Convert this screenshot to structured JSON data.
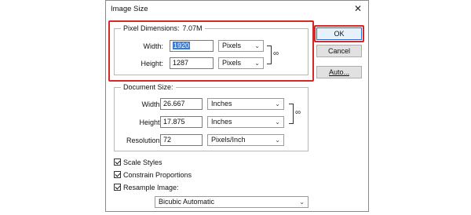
{
  "dialog": {
    "title": "Image Size",
    "close_glyph": "✕"
  },
  "pixel_dimensions": {
    "label": "Pixel Dimensions:",
    "value": "7.07M",
    "width_label": "Width:",
    "width_value": "1920",
    "width_unit": "Pixels",
    "height_label": "Height:",
    "height_value": "1287",
    "height_unit": "Pixels",
    "link_icon": "chain-link"
  },
  "document_size": {
    "label": "Document Size:",
    "width_label": "Width:",
    "width_value": "26.667",
    "width_unit": "Inches",
    "height_label": "Height:",
    "height_value": "17.875",
    "height_unit": "Inches",
    "resolution_label": "Resolution:",
    "resolution_value": "72",
    "resolution_unit": "Pixels/Inch"
  },
  "buttons": {
    "ok": "OK",
    "cancel": "Cancel",
    "auto": "Auto..."
  },
  "options": {
    "scale_styles": "Scale Styles",
    "constrain_proportions": "Constrain Proportions",
    "resample_image": "Resample Image:",
    "resample_method": "Bicubic Automatic"
  },
  "colors": {
    "highlight": "#d62828",
    "selection": "#3a7bd5"
  }
}
